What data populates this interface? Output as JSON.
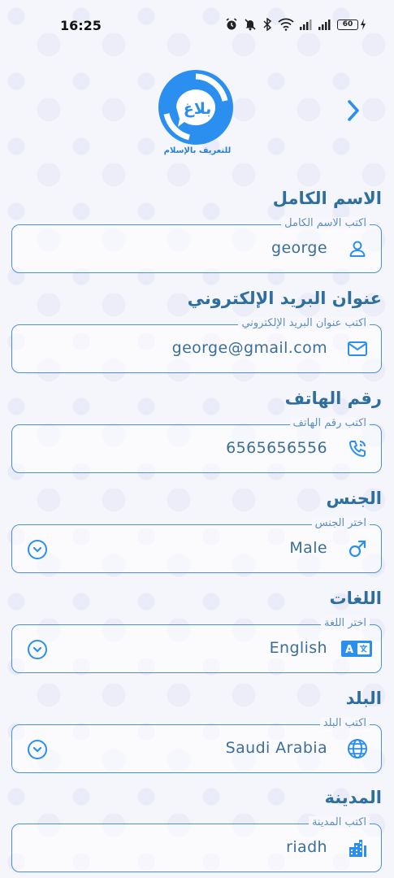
{
  "status_bar": {
    "time": "16:25",
    "battery": "60"
  },
  "logo": {
    "text": "بلاغ",
    "tagline": "للتعريف بالإسلام",
    "color": "#2b8ff0"
  },
  "form": {
    "fields": [
      {
        "label": "الاسم الكامل",
        "hint": "اكتب الاسم الكامل",
        "value": "george",
        "icon": "user-icon"
      },
      {
        "label": "عنوان البريد الإلكتروني",
        "hint": "اكتب عنوان البريد الإلكتروني",
        "value": "george@gmail.com",
        "icon": "mail-icon"
      },
      {
        "label": "رقم الهاتف",
        "hint": "اكتب رقم الهاتف",
        "value": "6565656556",
        "icon": "phone-icon"
      },
      {
        "label": "الجنس",
        "hint": "اختر الجنس",
        "value": "Male",
        "icon": "male-icon",
        "dropdown": true
      },
      {
        "label": "اللغات",
        "hint": "اختر اللغة",
        "value": "English",
        "icon": "translate-icon",
        "dropdown": true
      },
      {
        "label": "البلد",
        "hint": "اكتب البلد",
        "value": "Saudi Arabia",
        "icon": "globe-icon",
        "dropdown": true
      },
      {
        "label": "المدينة",
        "hint": "اكتب المدينة",
        "value": "riadh",
        "icon": "city-icon"
      }
    ]
  },
  "colors": {
    "accent": "#2b8ff0",
    "label": "#2f6f9e",
    "border": "#4a90d9"
  }
}
